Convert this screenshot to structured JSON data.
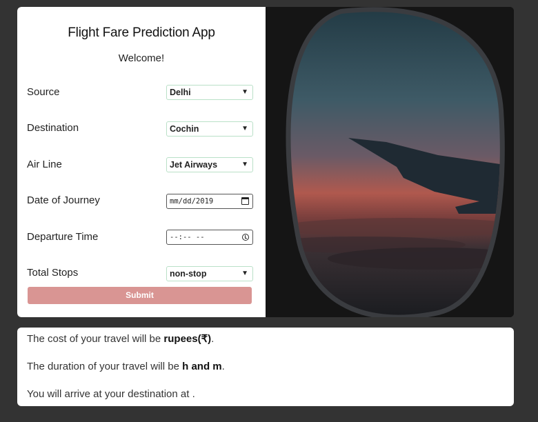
{
  "form": {
    "title": "Flight Fare Prediction App",
    "welcome": "Welcome!",
    "source": {
      "label": "Source",
      "value": "Delhi"
    },
    "destination": {
      "label": "Destination",
      "value": "Cochin"
    },
    "airline": {
      "label": "Air Line",
      "value": "Jet Airways"
    },
    "date": {
      "label": "Date of Journey",
      "value": "mm/dd/2019"
    },
    "departure": {
      "label": "Departure Time",
      "value": "--:-- --"
    },
    "stops": {
      "label": "Total Stops",
      "value": "non-stop"
    },
    "submit_label": "Submit"
  },
  "colors": {
    "page_bg": "#333333",
    "submit_bg": "#d99593",
    "field_border": "#b9e0c7"
  },
  "result": {
    "cost_prefix": "The cost of your travel will be ",
    "cost_value": "rupees(₹)",
    "cost_suffix": ".",
    "duration_prefix": "The duration of your travel will be ",
    "duration_value": "h and m",
    "duration_suffix": ".",
    "arrival_text": "You will arrive at your destination at ."
  }
}
